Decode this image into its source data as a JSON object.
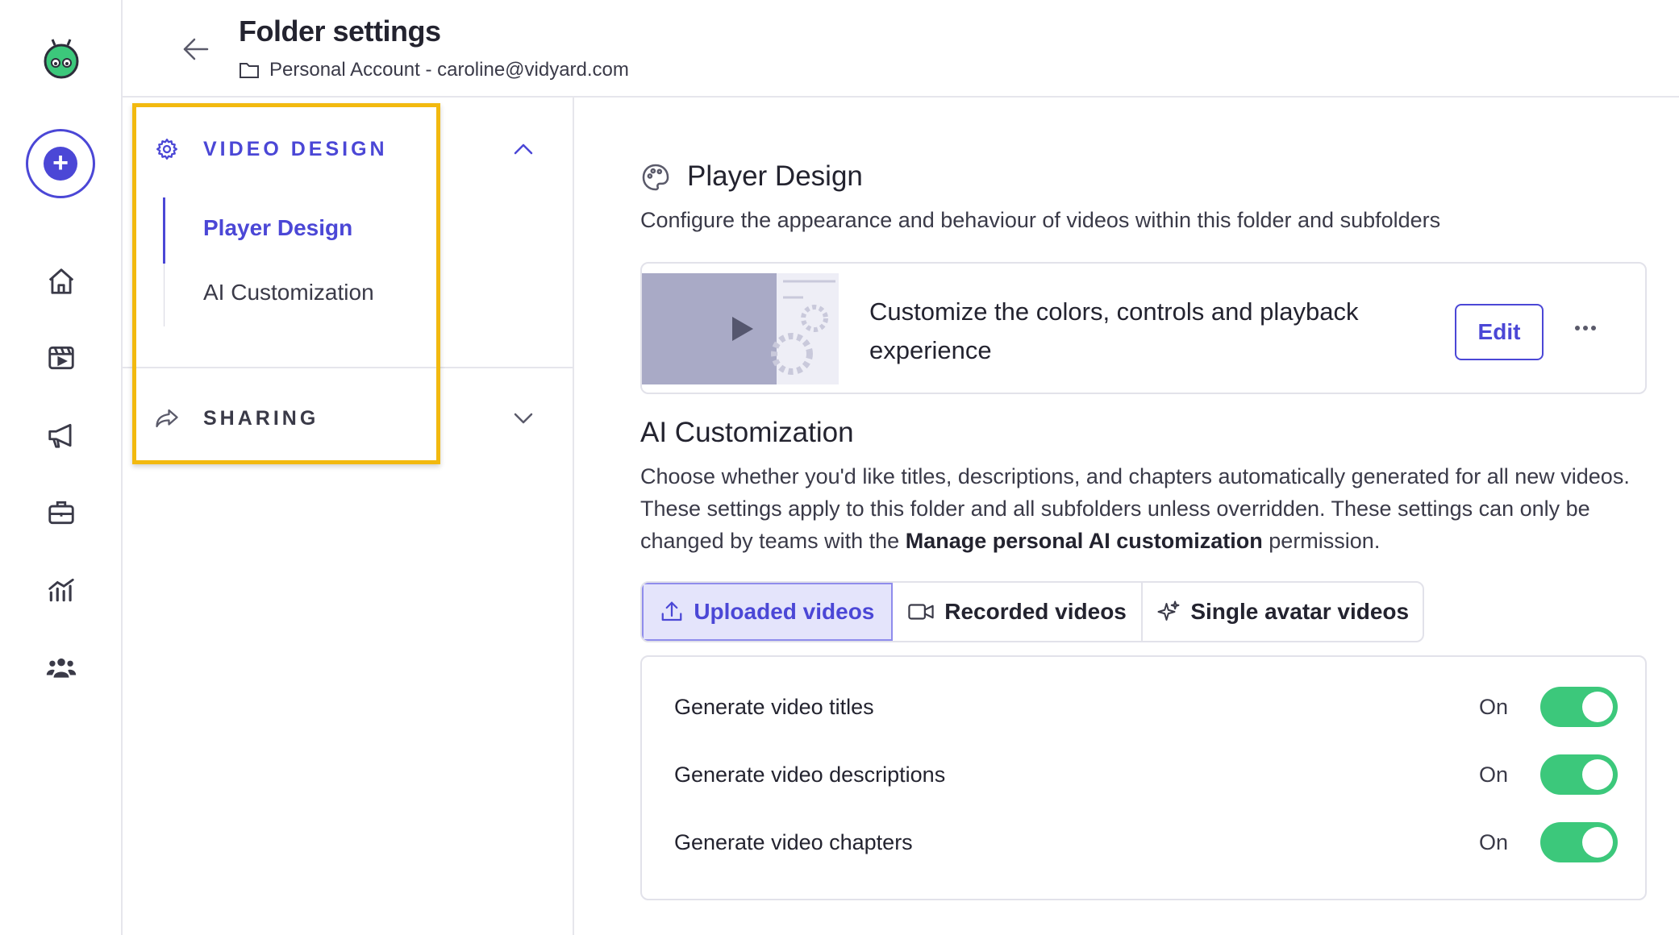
{
  "header": {
    "title": "Folder settings",
    "breadcrumb": "Personal Account - caroline@vidyard.com"
  },
  "nav": {
    "icons": [
      "vidyard-logo-icon",
      "create-icon",
      "home-icon",
      "library-icon",
      "megaphone-icon",
      "briefcase-icon",
      "analytics-icon",
      "team-icon"
    ]
  },
  "sidebar": {
    "video_design": {
      "label": "VIDEO DESIGN",
      "items": [
        "Player Design",
        "AI Customization"
      ]
    },
    "sharing": {
      "label": "SHARING"
    }
  },
  "player_design": {
    "title": "Player Design",
    "description": "Configure the appearance and behaviour of videos within this folder and subfolders",
    "card_text": "Customize the colors, controls and playback experience",
    "edit_label": "Edit"
  },
  "ai_customization": {
    "title": "AI Customization",
    "description_part1": "Choose whether you'd like titles, descriptions, and chapters automatically generated for all new videos. These settings apply to this folder and all subfolders unless overridden. These settings can only be changed by teams with the ",
    "description_bold": "Manage personal AI customization",
    "description_part2": " permission.",
    "tabs": [
      "Uploaded videos",
      "Recorded videos",
      "Single avatar videos"
    ],
    "active_tab": "Uploaded videos",
    "settings": [
      {
        "label": "Generate video titles",
        "state": "On"
      },
      {
        "label": "Generate video descriptions",
        "state": "On"
      },
      {
        "label": "Generate video chapters",
        "state": "On"
      }
    ]
  },
  "colors": {
    "accent": "#4b47d6",
    "toggle_on": "#3cc87b",
    "highlight": "#f2b90f"
  }
}
